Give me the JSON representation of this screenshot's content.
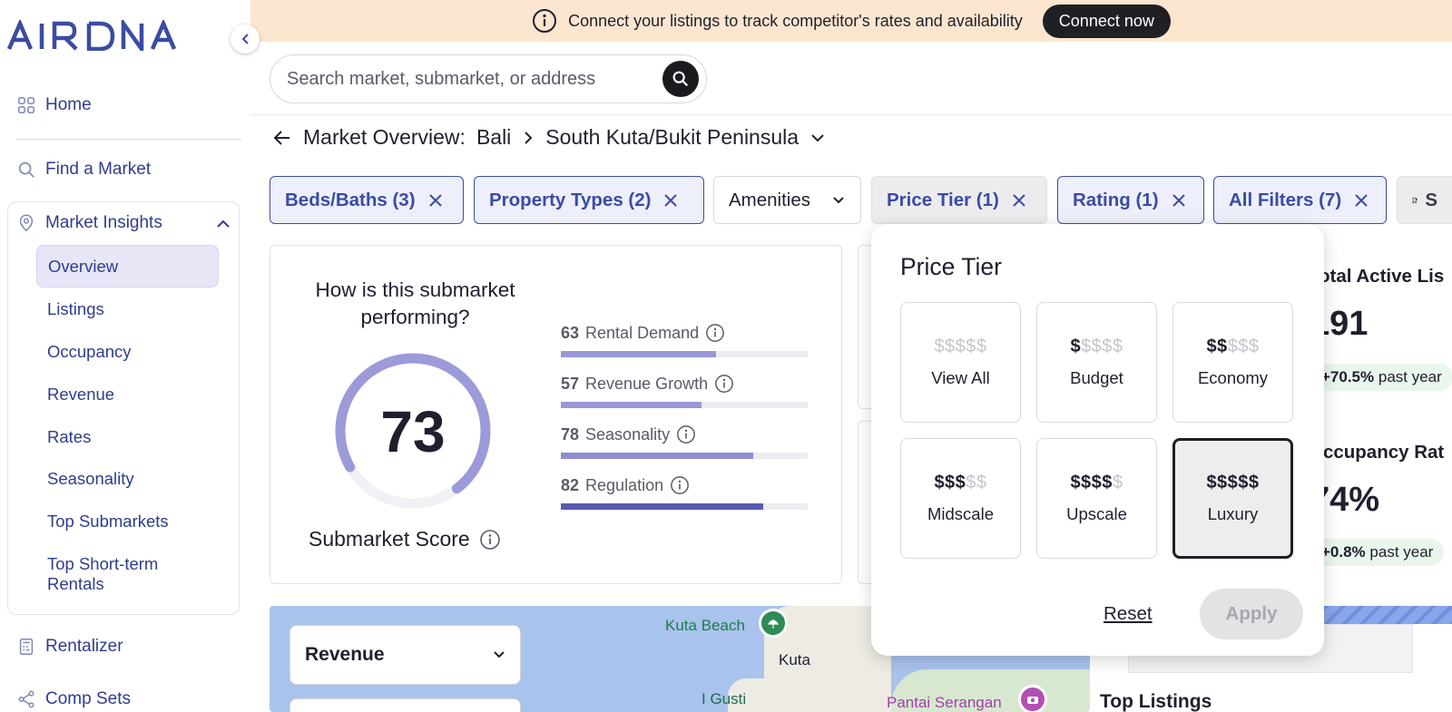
{
  "brand": {
    "logo_text": "AIRDNA"
  },
  "banner": {
    "text": "Connect your listings to track competitor's rates and availability",
    "cta": "Connect now"
  },
  "search": {
    "placeholder": "Search market, submarket, or address"
  },
  "sidebar": {
    "home": "Home",
    "find_market": "Find a Market",
    "market_insights": "Market Insights",
    "sub_items": [
      "Overview",
      "Listings",
      "Occupancy",
      "Revenue",
      "Rates",
      "Seasonality",
      "Top Submarkets",
      "Top Short-term Rentals"
    ],
    "rentalizer": "Rentalizer",
    "comp_sets": "Comp Sets"
  },
  "breadcrumb": {
    "prefix": "Market Overview:",
    "market": "Bali",
    "submarket": "South Kuta/Bukit Peninsula"
  },
  "filters": {
    "beds_baths": "Beds/Baths (3)",
    "property_types": "Property Types (2)",
    "amenities": "Amenities",
    "price_tier": "Price Tier (1)",
    "rating": "Rating (1)",
    "all_filters": "All Filters (7)",
    "save_partial": "S"
  },
  "score_card": {
    "question": "How is this submarket performing?",
    "score": "73",
    "score_value": 73,
    "label": "Submarket Score",
    "metrics": [
      {
        "num": "63",
        "label": "Rental Demand",
        "value": 63,
        "color": "#9a98d8"
      },
      {
        "num": "57",
        "label": "Revenue Growth",
        "value": 57,
        "color": "#9a98d8"
      },
      {
        "num": "78",
        "label": "Seasonality",
        "value": 78,
        "color": "#8f8cd2"
      },
      {
        "num": "82",
        "label": "Regulation",
        "value": 82,
        "color": "#5a58b0"
      }
    ]
  },
  "stats": {
    "active_listings": {
      "title": "Total Active Lis",
      "value": "191",
      "change": "+70.5%",
      "suffix": "past year"
    },
    "occupancy": {
      "title": "Occupancy Rat",
      "value": "74%",
      "change": "+0.8%",
      "suffix": "past year"
    }
  },
  "map": {
    "metric_select": "Revenue",
    "labels": {
      "kuta_beach": "Kuta Beach",
      "kuta": "Kuta",
      "i_gusti": "I Gusti",
      "pantai": "Pantai Serangan"
    },
    "partial_text": "ts",
    "top_listings": "Top Listings"
  },
  "price_popover": {
    "title": "Price Tier",
    "tiers": [
      {
        "on": "",
        "off": "$$$$$",
        "name": "View All"
      },
      {
        "on": "$",
        "off": "$$$$",
        "name": "Budget"
      },
      {
        "on": "$$",
        "off": "$$$",
        "name": "Economy"
      },
      {
        "on": "$$$",
        "off": "$$",
        "name": "Midscale"
      },
      {
        "on": "$$$$",
        "off": "$",
        "name": "Upscale"
      },
      {
        "on": "$$$$$",
        "off": "",
        "name": "Luxury"
      }
    ],
    "selected": "Luxury",
    "reset": "Reset",
    "apply": "Apply"
  },
  "colors": {
    "brand_blue": "#2f3c8f",
    "chip_blue": "#3b4ba4",
    "gauge": "#9c9ad9",
    "banner": "#fde6cf"
  }
}
